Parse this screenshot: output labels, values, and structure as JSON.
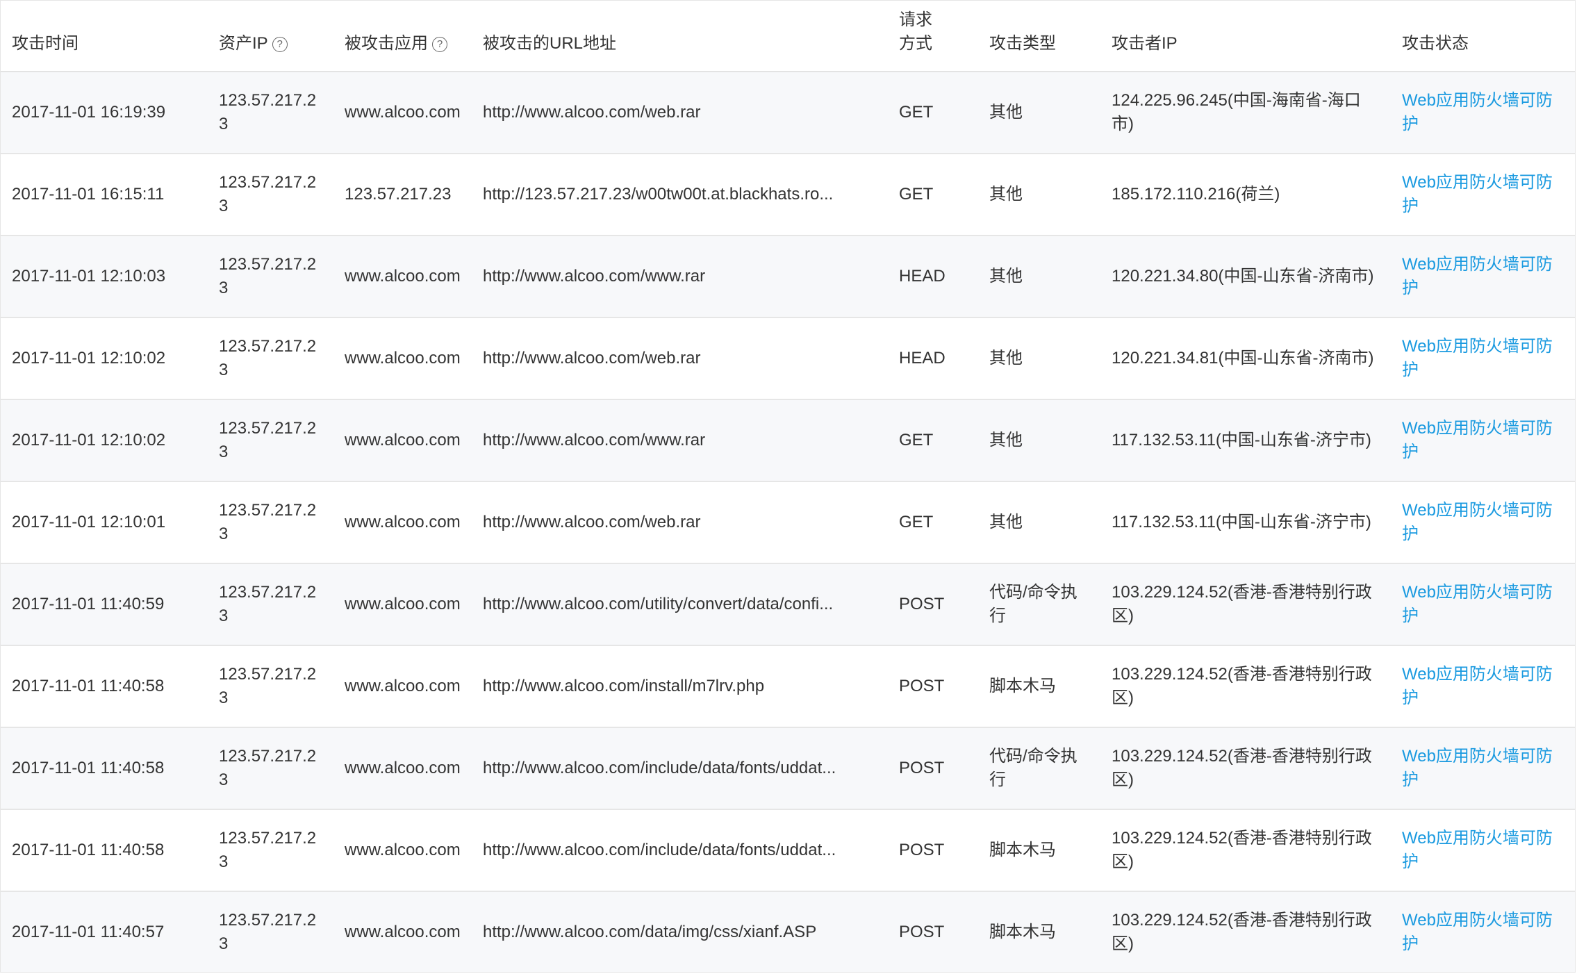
{
  "headers": {
    "time": "攻击时间",
    "asset_ip": "资产IP",
    "app": "被攻击应用",
    "url": "被攻击的URL地址",
    "method": "请求方式",
    "type": "攻击类型",
    "attacker_ip": "攻击者IP",
    "status": "攻击状态"
  },
  "icons": {
    "help": "question-circle-icon"
  },
  "colors": {
    "link": "#1a9ae0",
    "row_alt": "#f7f8fa",
    "border": "#e6e6e6"
  },
  "rows": [
    {
      "time": "2017-11-01 16:19:39",
      "asset_ip": "123.57.217.23",
      "app": "www.alcoo.com",
      "url": "http://www.alcoo.com/web.rar",
      "method": "GET",
      "type": "其他",
      "attacker_ip": "124.225.96.245(中国-海南省-海口市)",
      "status": "Web应用防火墙可防护"
    },
    {
      "time": "2017-11-01 16:15:11",
      "asset_ip": "123.57.217.23",
      "app": "123.57.217.23",
      "url": "http://123.57.217.23/w00tw00t.at.blackhats.ro...",
      "method": "GET",
      "type": "其他",
      "attacker_ip": "185.172.110.216(荷兰)",
      "status": "Web应用防火墙可防护"
    },
    {
      "time": "2017-11-01 12:10:03",
      "asset_ip": "123.57.217.23",
      "app": "www.alcoo.com",
      "url": "http://www.alcoo.com/www.rar",
      "method": "HEAD",
      "type": "其他",
      "attacker_ip": "120.221.34.80(中国-山东省-济南市)",
      "status": "Web应用防火墙可防护"
    },
    {
      "time": "2017-11-01 12:10:02",
      "asset_ip": "123.57.217.23",
      "app": "www.alcoo.com",
      "url": "http://www.alcoo.com/web.rar",
      "method": "HEAD",
      "type": "其他",
      "attacker_ip": "120.221.34.81(中国-山东省-济南市)",
      "status": "Web应用防火墙可防护"
    },
    {
      "time": "2017-11-01 12:10:02",
      "asset_ip": "123.57.217.23",
      "app": "www.alcoo.com",
      "url": "http://www.alcoo.com/www.rar",
      "method": "GET",
      "type": "其他",
      "attacker_ip": "117.132.53.11(中国-山东省-济宁市)",
      "status": "Web应用防火墙可防护"
    },
    {
      "time": "2017-11-01 12:10:01",
      "asset_ip": "123.57.217.23",
      "app": "www.alcoo.com",
      "url": "http://www.alcoo.com/web.rar",
      "method": "GET",
      "type": "其他",
      "attacker_ip": "117.132.53.11(中国-山东省-济宁市)",
      "status": "Web应用防火墙可防护"
    },
    {
      "time": "2017-11-01 11:40:59",
      "asset_ip": "123.57.217.23",
      "app": "www.alcoo.com",
      "url": "http://www.alcoo.com/utility/convert/data/confi...",
      "method": "POST",
      "type": "代码/命令执行",
      "attacker_ip": "103.229.124.52(香港-香港特别行政区)",
      "status": "Web应用防火墙可防护"
    },
    {
      "time": "2017-11-01 11:40:58",
      "asset_ip": "123.57.217.23",
      "app": "www.alcoo.com",
      "url": "http://www.alcoo.com/install/m7lrv.php",
      "method": "POST",
      "type": "脚本木马",
      "attacker_ip": "103.229.124.52(香港-香港特别行政区)",
      "status": "Web应用防火墙可防护"
    },
    {
      "time": "2017-11-01 11:40:58",
      "asset_ip": "123.57.217.23",
      "app": "www.alcoo.com",
      "url": "http://www.alcoo.com/include/data/fonts/uddat...",
      "method": "POST",
      "type": "代码/命令执行",
      "attacker_ip": "103.229.124.52(香港-香港特别行政区)",
      "status": "Web应用防火墙可防护"
    },
    {
      "time": "2017-11-01 11:40:58",
      "asset_ip": "123.57.217.23",
      "app": "www.alcoo.com",
      "url": "http://www.alcoo.com/include/data/fonts/uddat...",
      "method": "POST",
      "type": "脚本木马",
      "attacker_ip": "103.229.124.52(香港-香港特别行政区)",
      "status": "Web应用防火墙可防护"
    },
    {
      "time": "2017-11-01 11:40:57",
      "asset_ip": "123.57.217.23",
      "app": "www.alcoo.com",
      "url": "http://www.alcoo.com/data/img/css/xianf.ASP",
      "method": "POST",
      "type": "脚本木马",
      "attacker_ip": "103.229.124.52(香港-香港特别行政区)",
      "status": "Web应用防火墙可防护"
    }
  ]
}
